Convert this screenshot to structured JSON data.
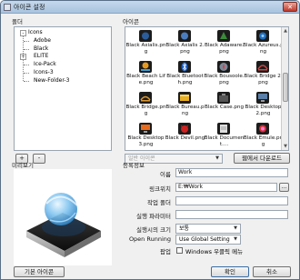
{
  "window": {
    "title": "아이콘 설정",
    "close_glyph": "✕"
  },
  "folders": {
    "label": "폴더",
    "items": [
      {
        "label": "Icons",
        "expander": "-"
      },
      {
        "label": "Adobe"
      },
      {
        "label": "Black"
      },
      {
        "label": "ELITE",
        "expander": "+"
      },
      {
        "label": "Ice-Pack"
      },
      {
        "label": "Icons-3"
      },
      {
        "label": "New-Folder-3"
      }
    ],
    "add_label": "+",
    "remove_label": "-"
  },
  "icons": {
    "label": "아이콘",
    "items": [
      {
        "label": "Black Axialis.png",
        "icon": "axialis-icon",
        "color": "#2b5d9a"
      },
      {
        "label": "Black Axialis 2.png",
        "icon": "axialis-2-icon",
        "color": "#2b5d9a"
      },
      {
        "label": "Black Adaware.png",
        "icon": "adaware-icon",
        "color": "#3a8a3a"
      },
      {
        "label": "Black Azureus.png",
        "icon": "azureus-icon",
        "color": "#1f6fbf"
      },
      {
        "label": "Black Beach Life.png",
        "icon": "beach-life-icon",
        "color": "#e59a1f"
      },
      {
        "label": "Black Bluetooth.png",
        "icon": "bluetooth-icon",
        "color": "#1f5fbf"
      },
      {
        "label": "Black Bousoole.png",
        "icon": "bousoole-icon",
        "color": "#7a8a9a"
      },
      {
        "label": "Black Bridge 2.png",
        "icon": "bridge-2-icon",
        "color": "#c44"
      },
      {
        "label": "Black Bridge.png",
        "icon": "bridge-icon",
        "color": "#d93"
      },
      {
        "label": "Black Bureau.png",
        "icon": "bureau-icon",
        "color": "#e8b022"
      },
      {
        "label": "Black Case.png",
        "icon": "case-icon",
        "color": "#444"
      },
      {
        "label": "Black Desktop 2.png",
        "icon": "desktop-2-icon",
        "color": "#5a7fa8"
      },
      {
        "label": "Black Desktop 3.png",
        "icon": "desktop-3-icon",
        "color": "#e86a1a"
      },
      {
        "label": "Black Devil.png",
        "icon": "devil-icon",
        "color": "#c22"
      },
      {
        "label": "Black Document....",
        "icon": "document-icon",
        "color": "#ddd"
      },
      {
        "label": "Black Emule.png",
        "icon": "emule-icon",
        "color": "#c33"
      }
    ]
  },
  "icon_type_select": {
    "value": "일반 아이콘"
  },
  "download_button": {
    "label": "웹에서 다운로드"
  },
  "preview": {
    "label": "미리보기",
    "icon": "work-preview-icon"
  },
  "properties": {
    "label": "등록정보",
    "name_label": "이름",
    "name_value": "Work",
    "link_label": "링크위치",
    "link_value": "E:₩Work",
    "browse_label": "...",
    "work_folder_label": "작업 폴더",
    "work_folder_value": "",
    "params_label": "실행 파라미터",
    "params_value": "",
    "window_size_label": "실행시의 크기",
    "window_size_value": "보통",
    "open_running_label": "Open Running",
    "open_running_value": "Use Global Setting",
    "popup_label": "팝업",
    "popup_checkbox_label": "Windows 우클릭 메뉴"
  },
  "footer": {
    "default_icon_label": "기본 아이콘",
    "ok_label": "확인",
    "cancel_label": "취소"
  }
}
